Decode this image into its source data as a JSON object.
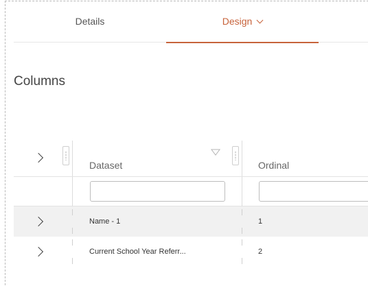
{
  "tabs": [
    {
      "label": "Details",
      "active": false
    },
    {
      "label": "Design",
      "active": true
    }
  ],
  "section_title": "Columns",
  "grid": {
    "columns": [
      {
        "header": "Dataset",
        "filter_value": ""
      },
      {
        "header": "Ordinal",
        "filter_value": ""
      }
    ],
    "rows": [
      {
        "dataset": "Name - 1",
        "ordinal": "1"
      },
      {
        "dataset": "Current School Year Referr...",
        "ordinal": "2"
      }
    ]
  },
  "colors": {
    "accent": "#c7623a",
    "stripe": "#f1f1f1",
    "border": "#dcdcdc"
  }
}
